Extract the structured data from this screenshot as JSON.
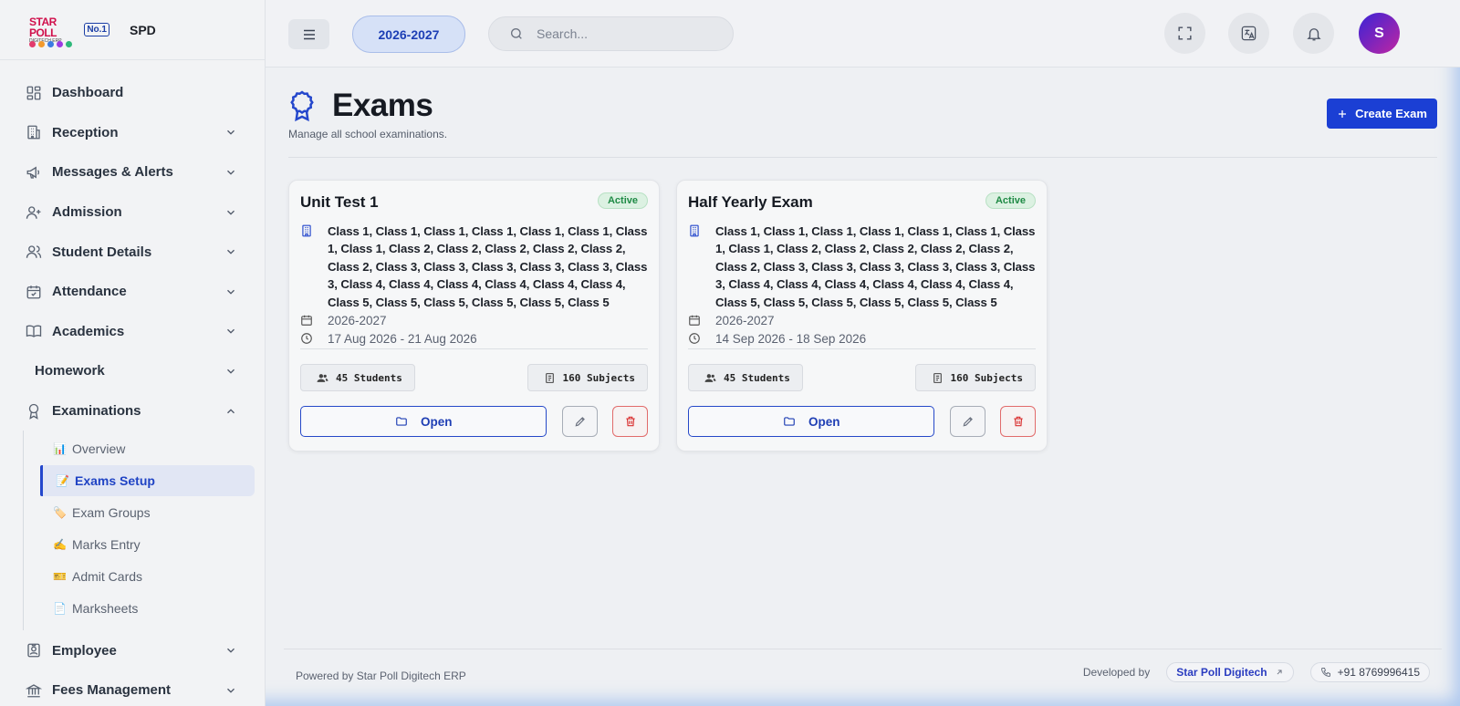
{
  "brand": {
    "logo_text": "STAR POLL",
    "logo_sub": "DIGITECH ERP",
    "logo_badge": "No.1",
    "name": "SPD"
  },
  "sidebar": {
    "items": [
      {
        "label": "Dashboard",
        "icon": "dashboard-icon"
      },
      {
        "label": "Reception",
        "icon": "building-icon"
      },
      {
        "label": "Messages & Alerts",
        "icon": "megaphone-icon"
      },
      {
        "label": "Admission",
        "icon": "user-plus-icon"
      },
      {
        "label": "Student Details",
        "icon": "users-icon"
      },
      {
        "label": "Attendance",
        "icon": "calendar-check-icon"
      },
      {
        "label": "Academics",
        "icon": "book-open-icon"
      },
      {
        "label": "Homework"
      },
      {
        "label": "Examinations",
        "icon": "award-icon"
      }
    ],
    "exam_sub": [
      {
        "emoji": "📊",
        "label": "Overview"
      },
      {
        "emoji": "📝",
        "label": "Exams Setup"
      },
      {
        "emoji": "🏷️",
        "label": "Exam Groups"
      },
      {
        "emoji": "✍️",
        "label": "Marks Entry"
      },
      {
        "emoji": "🎫",
        "label": "Admit Cards"
      },
      {
        "emoji": "📄",
        "label": "Marksheets"
      }
    ],
    "after": [
      {
        "label": "Employee",
        "icon": "id-badge-icon"
      },
      {
        "label": "Fees Management",
        "icon": "bank-icon"
      }
    ]
  },
  "topbar": {
    "session": "2026-2027",
    "search_placeholder": "Search...",
    "avatar_initial": "S"
  },
  "page": {
    "title": "Exams",
    "subtitle": "Manage all school examinations.",
    "create_label": "Create Exam"
  },
  "exams": [
    {
      "name": "Unit Test 1",
      "status": "Active",
      "classes": "Class 1, Class 1, Class 1, Class 1, Class 1, Class 1, Class 1, Class 1, Class 2, Class 2, Class 2, Class 2, Class 2, Class 2, Class 3, Class 3, Class 3, Class 3, Class 3, Class 3, Class 4, Class 4, Class 4, Class 4, Class 4, Class 4, Class 5, Class 5, Class 5, Class 5, Class 5, Class 5",
      "session": "2026-2027",
      "dates": "17 Aug 2026 - 21 Aug 2026",
      "students": "45 Students",
      "subjects": "160 Subjects",
      "open_label": "Open"
    },
    {
      "name": "Half Yearly Exam",
      "status": "Active",
      "classes": "Class 1, Class 1, Class 1, Class 1, Class 1, Class 1, Class 1, Class 1, Class 2, Class 2, Class 2, Class 2, Class 2, Class 2, Class 3, Class 3, Class 3, Class 3, Class 3, Class 3, Class 4, Class 4, Class 4, Class 4, Class 4, Class 4, Class 5, Class 5, Class 5, Class 5, Class 5, Class 5",
      "session": "2026-2027",
      "dates": "14 Sep 2026 - 18 Sep 2026",
      "students": "45 Students",
      "subjects": "160 Subjects",
      "open_label": "Open"
    }
  ],
  "footer": {
    "powered": "Powered by Star Poll Digitech ERP",
    "developed_by": "Developed by",
    "developer": "Star Poll Digitech",
    "phone": "+91 8769996415"
  },
  "colors": {
    "accent": "#1b3fd4",
    "active_badge": "#1f8a45",
    "danger": "#d93030"
  }
}
